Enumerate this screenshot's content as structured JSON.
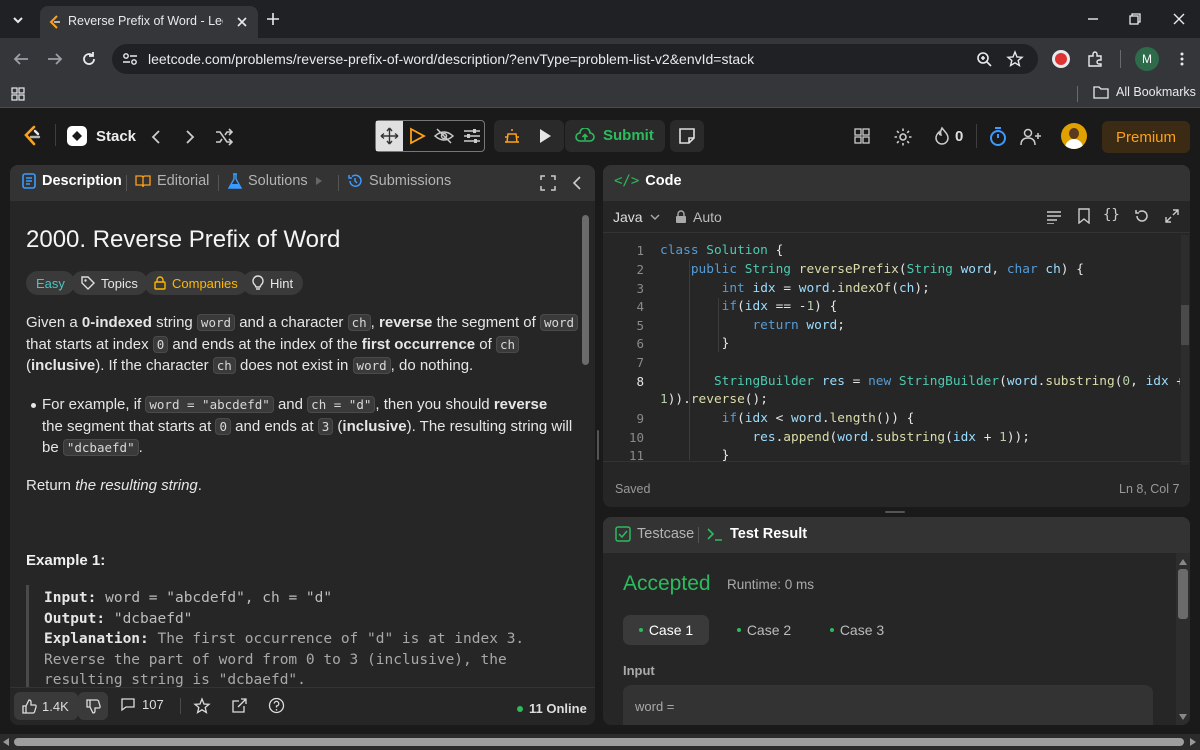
{
  "browser": {
    "tab_title": "Reverse Prefix of Word - LeetCode",
    "url": "leetcode.com/problems/reverse-prefix-of-word/description/?envType=problem-list-v2&envId=stack",
    "bookmarks_label": "All Bookmarks",
    "profile_initial": "M"
  },
  "nav": {
    "list_name": "Stack",
    "submit_label": "Submit",
    "streak_count": "0",
    "premium_label": "Premium"
  },
  "left_panel": {
    "tabs": [
      {
        "label": "Description",
        "active": true
      },
      {
        "label": "Editorial"
      },
      {
        "label": "Solutions"
      },
      {
        "label": "Submissions"
      }
    ],
    "title": "2000. Reverse Prefix of Word",
    "chips": {
      "difficulty": "Easy",
      "topics": "Topics",
      "companies": "Companies",
      "hint": "Hint"
    },
    "desc": {
      "t1": "Given a ",
      "b1": "0-indexed",
      "t2": " string ",
      "c1": "word",
      "t3": " and a character ",
      "c2": "ch",
      "t4": ", ",
      "b2": "reverse",
      "t5": " the segment of ",
      "c3": "word",
      "t6": "that starts at index ",
      "c4": "0",
      "t7": " and ends at the index of the ",
      "b3": "first occurrence",
      "t8": " of ",
      "c5": "ch",
      "t9": "(",
      "b4": "inclusive",
      "t10": "). If the character ",
      "c6": "ch",
      "t11": " does not exist in ",
      "c7": "word",
      "t12": ", do nothing."
    },
    "bullet": {
      "t1": "For example, if ",
      "c1": "word = \"abcdefd\"",
      "t2": " and ",
      "c2": "ch = \"d\"",
      "t3": ", then you should ",
      "b1": "reverse",
      "t4": "the segment that starts at ",
      "c3": "0",
      "t5": " and ends at ",
      "c4": "3",
      "t6": " (",
      "b2": "inclusive",
      "t7": "). The resulting string will",
      "t8": "be ",
      "c5": "\"dcbaefd\"",
      "t9": "."
    },
    "return": {
      "t1": "Return ",
      "i1": "the resulting string",
      "t2": "."
    },
    "example": {
      "heading": "Example 1:",
      "input_label": "Input:",
      "input_value": "word = \"abcdefd\", ch = \"d\"",
      "output_label": "Output:",
      "output_value": "\"dcbaefd\"",
      "explanation_label": "Explanation:",
      "explanation_1": "The first occurrence of \"d\" is at index 3.",
      "explanation_2": "Reverse the part of word from 0 to 3 (inclusive), the",
      "explanation_3": "resulting string is \"dcbaefd\"."
    },
    "footer": {
      "likes": "1.4K",
      "comments": "107",
      "online": "11 Online"
    }
  },
  "code_panel": {
    "title": "Code",
    "language": "Java",
    "mode": "Auto",
    "status": "Saved",
    "cursor": "Ln 8, Col 7",
    "line_numbers": [
      "1",
      "2",
      "3",
      "4",
      "5",
      "6",
      "7",
      "8",
      "9",
      "10",
      "11"
    ]
  },
  "test_panel": {
    "tab_testcase": "Testcase",
    "tab_result": "Test Result",
    "verdict": "Accepted",
    "runtime": "Runtime: 0 ms",
    "cases": [
      "Case 1",
      "Case 2",
      "Case 3"
    ],
    "input_label": "Input",
    "input_var": "word ="
  },
  "colors": {
    "accent_green": "#2cbb5d",
    "easy_teal": "#46c6c2",
    "companies_gold": "#ffb800",
    "premium_orange": "#ffa116"
  }
}
